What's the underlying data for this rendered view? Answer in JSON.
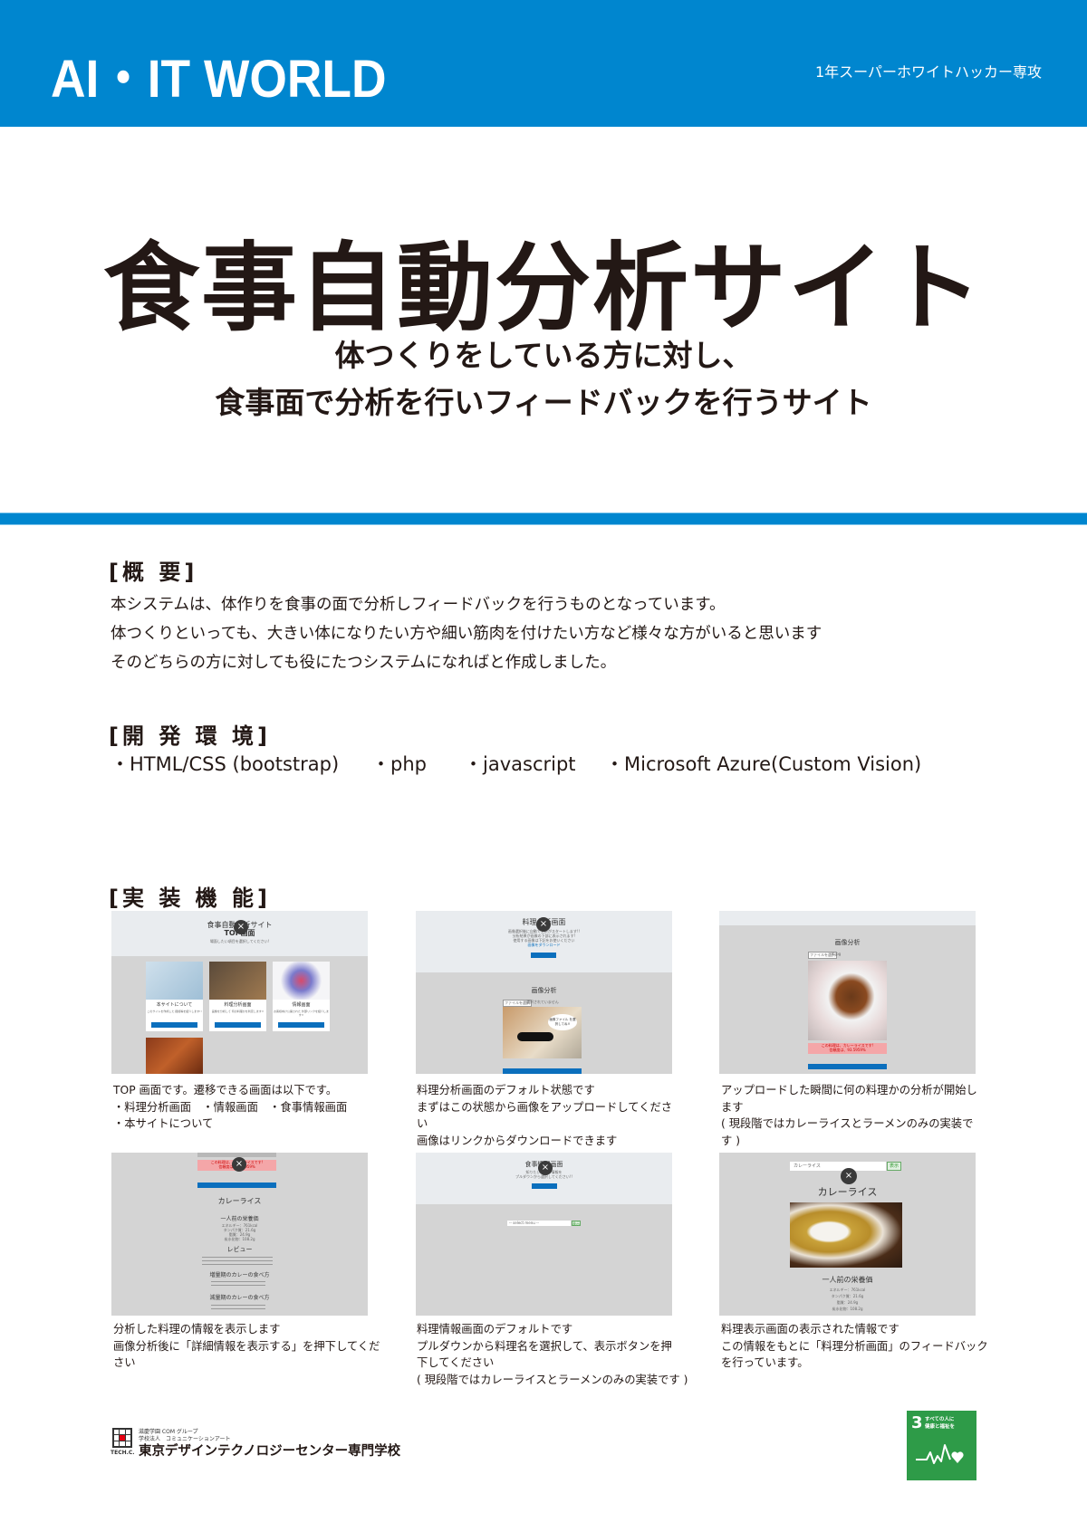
{
  "header": {
    "title": "AI・IT WORLD",
    "department": "1年スーパーホワイトハッカー専攻",
    "brand_color": "#0086cf"
  },
  "hero": {
    "title": "食事自動分析サイト",
    "subtitle_line1": "体つくりをしている方に対し、",
    "subtitle_line2": "食事面で分析を行いフィードバックを行うサイト"
  },
  "overview": {
    "heading": "[概 要]",
    "lines": [
      "本システムは、体作りを食事の面で分析しフィードバックを行うものとなっています。",
      "体つくりといっても、大きい体になりたい方や細い筋肉を付けたい方など様々な方がいると思います",
      "そのどちらの方に対しても役にたつシステムになればと作成しました。"
    ]
  },
  "environment": {
    "heading": "[開 発 環 境]",
    "items": [
      "・HTML/CSS (bootstrap)",
      "・php",
      "・javascript",
      "・Microsoft Azure(Custom Vision)"
    ]
  },
  "features": {
    "heading": "[実 装 機 能]",
    "screenshots": [
      {
        "screen_title": "食事自動分析サイト",
        "screen_subtitle": "TOP画面",
        "screen_note": "場面したい項目を選択してください!",
        "cards": [
          {
            "title": "本サイトについて",
            "desc": "このサイトを作成した 経緯等を紹介します!!",
            "button": "選択"
          },
          {
            "title": "料理分析画面",
            "desc": "画像を分析して 何の料理かを判定します!!",
            "button": "選択"
          },
          {
            "title": "情報画面",
            "desc": "お客様向け公開された 外部リンクを紹介します!!",
            "button": "選択"
          }
        ],
        "caption": [
          "TOP 画面です。遷移できる画面は以下です。",
          "・料理分析画面　・情報画面　・食事情報画面",
          "・本サイトについて"
        ]
      },
      {
        "screen_title": "料理分析画面",
        "screen_lines": [
          "画像選択後に自動で分析がスタートします!!",
          "分析結果が画像の下部に表示されます!",
          "使用する画像は下記をお使いください"
        ],
        "download_link": "画像をダウンロード",
        "top_button": "TOPページへ戻る",
        "section_title": "画像分析",
        "file_button": "ファイルを選択",
        "file_status": "選択されていません",
        "bubble_text": "画像ファイル を選択してね!!",
        "bottom_button": "詳細情報を表示する",
        "caption": [
          "料理分析画面のデフォルト状態です",
          "まずはこの状態から画像をアップロードしてくださ",
          "い",
          "画像はリンクからダウンロードできます"
        ]
      },
      {
        "section_title": "画像分析",
        "file_button": "ファイルを選択",
        "file_name": "X.jpg",
        "result_line1": "この料理は、カレーライスです!",
        "result_line2": "信頼度は、93.5959%",
        "bottom_button": "詳細情報を表示する",
        "caption": [
          "アップロードした瞬間に何の料理かの分析が開始し",
          "ます",
          "( 現段階ではカレーライスとラーメンのみの実装で",
          "す )"
        ]
      },
      {
        "result_line1": "この料理は、カレーライスです!",
        "result_line2": "信頼度は、93.5959%",
        "detail_button": "詳細情報を表示する",
        "dish_title": "カレーライス",
        "nutrition_title": "一人前の栄養価",
        "nutrition_lines": [
          "エネルギー：761kcal",
          "タンパク質：21.6g",
          "脂質：24.9g",
          "炭水化物：108.2g"
        ],
        "review_title": "レビュー",
        "bulk_title": "増量期のカレーの食べ方",
        "cut_title": "減量期のカレーの食べ方",
        "caption": [
          "分析した料理の情報を表示します",
          "画像分析後に「詳細情報を表示する」を押下してください"
        ]
      },
      {
        "screen_title": "食事情報画面",
        "screen_lines": [
          "知りたい料理の情報を",
          "プルダウンから選択してください!!"
        ],
        "top_button": "TOPページへ戻る",
        "select_placeholder": "-- select menu --",
        "show_button": "表示",
        "caption": [
          "料理情報画面のデフォルトです",
          "プルダウンから料理名を選択して、表示ボタンを押",
          "下してください",
          "( 現段階ではカレーライスとラーメンのみの実装です )"
        ]
      },
      {
        "select_value": "カレーライス",
        "show_button": "表示",
        "dish_title": "カレーライス",
        "nutrition_title": "一人前の栄養価",
        "nutrition_lines": [
          "エネルギー：761kcal",
          "タンパク質：21.6g",
          "脂質：24.9g",
          "炭水化物：108.2g"
        ],
        "caption": [
          "料理表示画面の表示された情報です",
          "この情報をもとに「料理分析画面」のフィードバック",
          "を行っています。"
        ]
      }
    ],
    "close_glyph": "×"
  },
  "footer": {
    "logo_label": "TECH.C.",
    "group_line": "滋慶学園 COM グループ",
    "corp_line": "学校法人　コミュニケーションアート",
    "school_name": "東京デザインテクノロジーセンター専門学校",
    "sdg": {
      "number": "3",
      "text_line1": "すべての人に",
      "text_line2": "健康と福祉を",
      "color": "#2e9b48"
    }
  }
}
